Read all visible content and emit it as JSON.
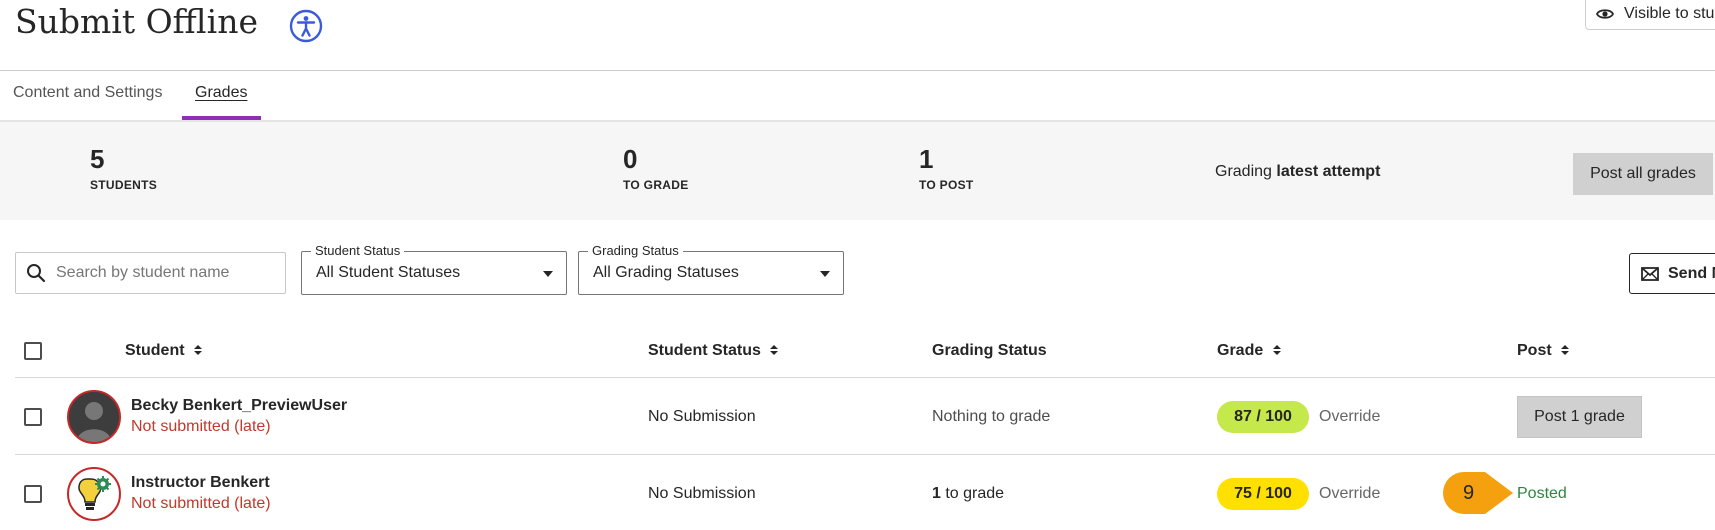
{
  "header": {
    "title": "Submit Offline",
    "visibility_label": "Visible to stu"
  },
  "tabs": [
    {
      "label": "Content and Settings",
      "active": false
    },
    {
      "label": "Grades",
      "active": true
    }
  ],
  "summary": {
    "students_count": "5",
    "students_label": "STUDENTS",
    "to_grade_count": "0",
    "to_grade_label": "TO GRADE",
    "to_post_count": "1",
    "to_post_label": "TO POST",
    "grading_prefix": "Grading",
    "grading_mode": "latest attempt",
    "post_all_label": "Post all grades"
  },
  "filters": {
    "search_placeholder": "Search by student name",
    "student_status_legend": "Student Status",
    "student_status_value": "All Student Statuses",
    "grading_status_legend": "Grading Status",
    "grading_status_value": "All Grading Statuses",
    "send_label": "Send M"
  },
  "table": {
    "headers": {
      "student": "Student",
      "student_status": "Student Status",
      "grading_status": "Grading Status",
      "grade": "Grade",
      "post": "Post"
    },
    "rows": [
      {
        "name": "Becky Benkert_PreviewUser",
        "submission": "Not submitted (late)",
        "student_status": "No Submission",
        "grading_status": "Nothing to grade",
        "grade": "87  / 100",
        "grade_color": "#c5e84a",
        "override": "Override",
        "post_action": "Post 1 grade"
      },
      {
        "name": "Instructor Benkert",
        "submission": "Not submitted (late)",
        "student_status": "No Submission",
        "grading_count": "1",
        "grading_suffix": " to grade",
        "grade": "75  / 100",
        "grade_color": "#ffe000",
        "override": "Override",
        "post_status": "Posted"
      }
    ]
  },
  "annotation_marker": "9",
  "colors": {
    "accent": "#8e2fb5",
    "error": "#c0392b",
    "success": "#2e8540",
    "accessibility_icon": "#3b5bdb",
    "marker": "#f5a00f"
  }
}
